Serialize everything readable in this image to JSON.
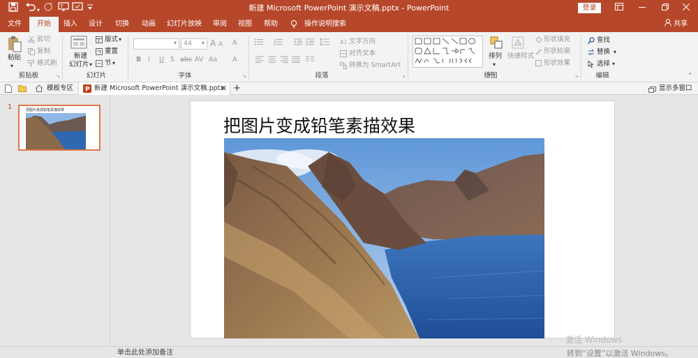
{
  "app": {
    "title": "新建 Microsoft PowerPoint 演示文稿.pptx  -  PowerPoint",
    "login_label": "登录",
    "share_label": "共享"
  },
  "tabs": [
    "文件",
    "开始",
    "插入",
    "设计",
    "切换",
    "动画",
    "幻灯片放映",
    "审阅",
    "视图",
    "帮助"
  ],
  "active_tab": "开始",
  "tell_me": "操作说明搜索",
  "ribbon": {
    "clipboard": {
      "label": "剪贴板",
      "paste": "粘贴",
      "cut": "剪切",
      "copy": "复制",
      "format_painter": "格式刷"
    },
    "slides": {
      "label": "幻灯片",
      "new_slide_line1": "新建",
      "new_slide_line2": "幻灯片",
      "layout": "版式",
      "reset": "重置",
      "section": "节"
    },
    "font": {
      "label": "字体",
      "font_name": "",
      "font_size": "44",
      "bold": "B",
      "italic": "I",
      "underline": "U",
      "strike": "S",
      "shadow": "abc",
      "spacing": "AV",
      "case": "Aa",
      "clear": "A",
      "color": "A"
    },
    "paragraph": {
      "label": "段落",
      "text_direction": "文字方向",
      "align_text": "对齐文本",
      "smartart": "转换为 SmartArt"
    },
    "drawing": {
      "label": "绘图",
      "arrange": "排列",
      "quick_styles": "快速样式",
      "shape_fill": "形状填充",
      "shape_outline": "形状轮廓",
      "shape_effects": "形状效果"
    },
    "editing": {
      "label": "编辑",
      "find": "查找",
      "replace": "替换",
      "select": "选择"
    }
  },
  "doc_tabs": {
    "template": "模板专区",
    "document": "新建 Microsoft PowerPoint 演示文稿.pptx",
    "multi_window": "显示多窗口"
  },
  "slide_panel": {
    "slide_number": "1",
    "thumbnail_title": "把图片变成铅笔素描效果"
  },
  "slide": {
    "title": "把图片变成铅笔素描效果"
  },
  "notes_placeholder": "单击此处添加备注",
  "activate": {
    "line1": "激活 Windows",
    "line2": "转到“设置”以激活 Windows。"
  },
  "colors": {
    "accent": "#b7472a",
    "selected_outline": "#e0774d"
  }
}
